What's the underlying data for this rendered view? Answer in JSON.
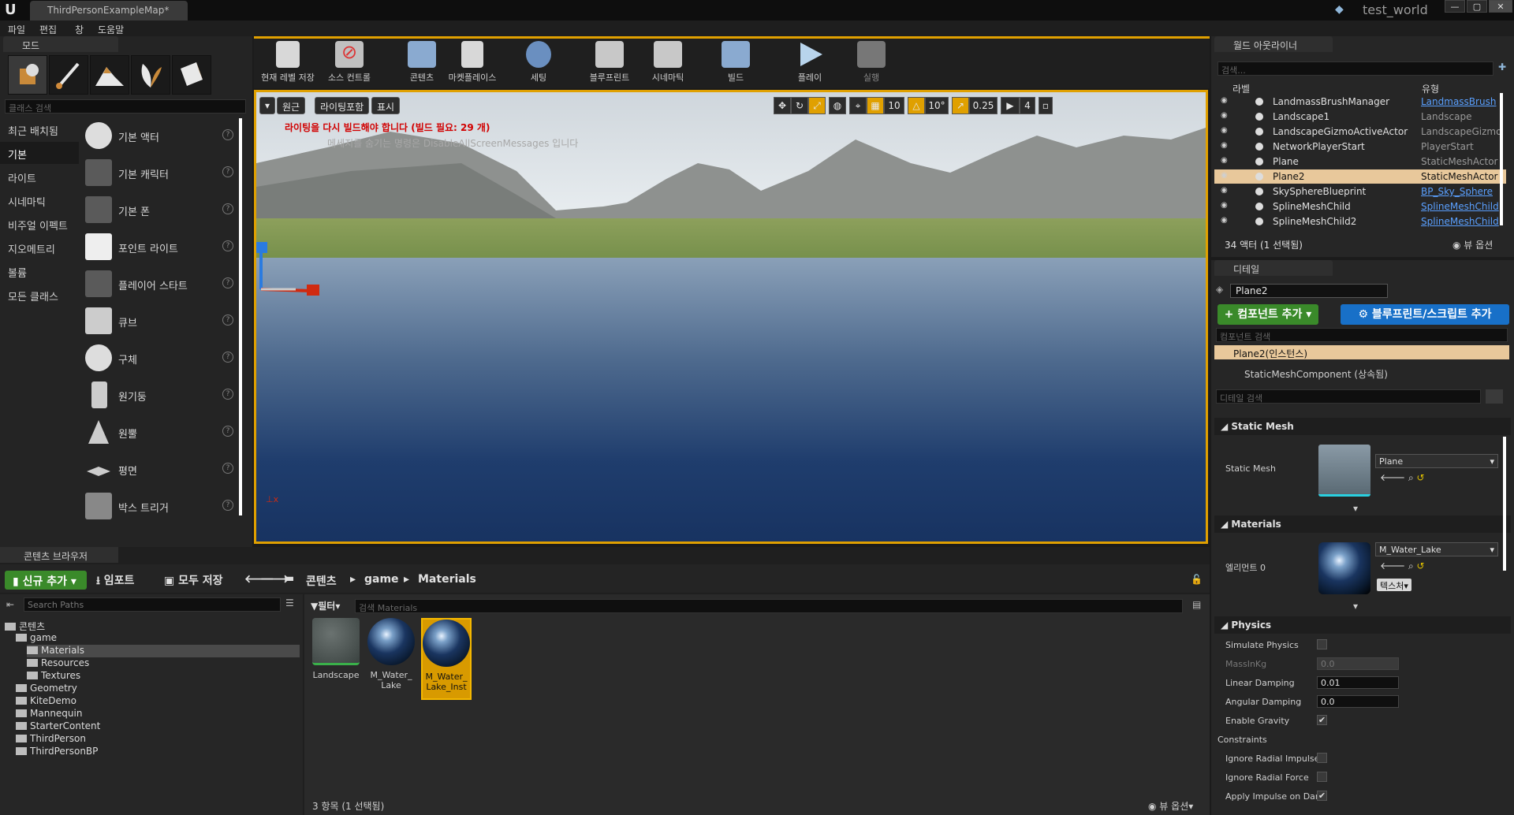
{
  "titlebar": {
    "tab": "ThirdPersonExampleMap*",
    "project": "test_world",
    "window_min": "—",
    "window_max": "▢",
    "window_close": "✕"
  },
  "menu": [
    "파일",
    "편집",
    "창",
    "도움말"
  ],
  "modes": {
    "tab": "모드",
    "search_placeholder": "클래스 검색",
    "categories": [
      "최근 배치됨",
      "기본",
      "라이트",
      "시네마틱",
      "비주얼 이펙트",
      "지오메트리",
      "볼륨",
      "모든 클래스"
    ],
    "items": [
      "기본 액터",
      "기본 캐릭터",
      "기본 폰",
      "포인트 라이트",
      "플레이어 스타트",
      "큐브",
      "구체",
      "원기둥",
      "원뿔",
      "평면",
      "박스 트리거"
    ]
  },
  "toolbar": {
    "buttons": [
      "현재 레벨 저장",
      "소스 컨트롤",
      "콘텐츠",
      "마켓플레이스",
      "세팅",
      "블루프린트",
      "시네마틱",
      "빌드",
      "플레이",
      "실행"
    ]
  },
  "viewport": {
    "perspective": "원근",
    "lit": "라이팅포함",
    "show": "표시",
    "warning": "라이팅을 다시 빌드해야 합니다 (빌드 필요: 29 개)",
    "hint": "메세지를 숨기는 명령은 DisableAllScreenMessages 입니다",
    "grid_snap": "10",
    "rot_snap": "10°",
    "scale_snap": "0.25",
    "cam_speed": "4"
  },
  "outliner": {
    "tab": "월드 아웃라이너",
    "search_placeholder": "검색...",
    "col_label": "라벨",
    "col_type": "유형",
    "rows": [
      {
        "name": "LandmassBrushManager",
        "type": "LandmassBrush",
        "link": true,
        "sel": false
      },
      {
        "name": "Landscape1",
        "type": "Landscape",
        "link": false,
        "sel": false
      },
      {
        "name": "LandscapeGizmoActiveActor",
        "type": "LandscapeGizmo",
        "link": false,
        "sel": false
      },
      {
        "name": "NetworkPlayerStart",
        "type": "PlayerStart",
        "link": false,
        "sel": false
      },
      {
        "name": "Plane",
        "type": "StaticMeshActor",
        "link": false,
        "sel": false
      },
      {
        "name": "Plane2",
        "type": "StaticMeshActor",
        "link": false,
        "sel": true
      },
      {
        "name": "SkySphereBlueprint",
        "type": "BP_Sky_Sphere",
        "link": true,
        "sel": false
      },
      {
        "name": "SplineMeshChild",
        "type": "SplineMeshChild",
        "link": true,
        "sel": false
      },
      {
        "name": "SplineMeshChild2",
        "type": "SplineMeshChild",
        "link": true,
        "sel": false
      }
    ],
    "count": "34 액터 (1 선택됨)",
    "view_options": "뷰 옵션"
  },
  "details": {
    "tab": "디테일",
    "name": "Plane2",
    "add_component": "컴포넌트 추가",
    "add_blueprint": "블루프린트/스크립트 추가",
    "component_search": "컴포넌트 검색",
    "root": "Plane2(인스턴스)",
    "child": "StaticMeshComponent (상속됨)",
    "detail_search": "디테일 검색",
    "sections": {
      "static_mesh": "Static Mesh",
      "materials": "Materials",
      "physics": "Physics"
    },
    "static_mesh_label": "Static Mesh",
    "static_mesh_value": "Plane",
    "element_label": "엘리먼트 0",
    "material_value": "M_Water_Lake",
    "texture_btn": "텍스처",
    "physics": [
      {
        "label": "Simulate Physics",
        "kind": "check",
        "value": ""
      },
      {
        "label": "MassInKg",
        "kind": "num",
        "value": "0.0"
      },
      {
        "label": "Linear Damping",
        "kind": "num",
        "value": "0.01"
      },
      {
        "label": "Angular Damping",
        "kind": "num",
        "value": "0.0"
      },
      {
        "label": "Enable Gravity",
        "kind": "check",
        "value": "✔"
      },
      {
        "label": "Constraints",
        "kind": "group",
        "value": ""
      },
      {
        "label": "Ignore Radial Impulse",
        "kind": "check",
        "value": ""
      },
      {
        "label": "Ignore Radial Force",
        "kind": "check",
        "value": ""
      },
      {
        "label": "Apply Impulse on Dam",
        "kind": "check",
        "value": "✔"
      }
    ]
  },
  "content_browser": {
    "tab": "콘텐츠 브라우저",
    "new_add": "신규 추가",
    "import": "임포트",
    "save_all": "모두 저장",
    "crumbs": [
      "콘텐츠",
      "game",
      "Materials"
    ],
    "path_search": "Search Paths",
    "filter": "필터",
    "asset_search": "검색 Materials",
    "tree": [
      {
        "label": "콘텐츠",
        "indent": 0,
        "sel": false
      },
      {
        "label": "game",
        "indent": 1,
        "sel": false
      },
      {
        "label": "Materials",
        "indent": 2,
        "sel": true
      },
      {
        "label": "Resources",
        "indent": 2,
        "sel": false
      },
      {
        "label": "Textures",
        "indent": 2,
        "sel": false
      },
      {
        "label": "Geometry",
        "indent": 1,
        "sel": false
      },
      {
        "label": "KiteDemo",
        "indent": 1,
        "sel": false
      },
      {
        "label": "Mannequin",
        "indent": 1,
        "sel": false
      },
      {
        "label": "StarterContent",
        "indent": 1,
        "sel": false
      },
      {
        "label": "ThirdPerson",
        "indent": 1,
        "sel": false
      },
      {
        "label": "ThirdPersonBP",
        "indent": 1,
        "sel": false
      }
    ],
    "assets": [
      {
        "name": "Landscape",
        "sel": false
      },
      {
        "name": "M_Water_\nLake",
        "sel": false
      },
      {
        "name": "M_Water_\nLake_Inst",
        "sel": true
      }
    ],
    "count": "3 항목 (1 선택됨)",
    "view_options": "뷰 옵션"
  }
}
